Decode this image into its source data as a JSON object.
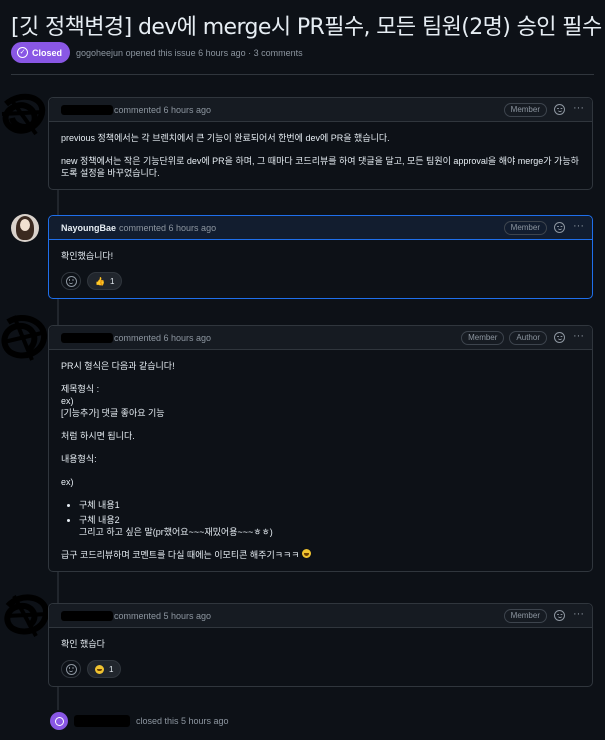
{
  "issue": {
    "title": "[깃 정책변경] dev에 merge시 PR필수, 모든 팀원(2명) 승인 필수",
    "state": "Closed",
    "meta": "gogoheejun opened this issue 6 hours ago · 3 comments"
  },
  "colors": {
    "background": "#0d1117",
    "closed_purple": "#8957e5",
    "highlight_blue": "#1f6feb",
    "border": "#30363d"
  },
  "comments": [
    {
      "author": "",
      "when": "commented 6 hours ago",
      "roles": [
        "Member"
      ],
      "body": [
        "previous 정책에서는 각 브렌치에서 큰 기능이 완료되어서 한번에 dev에 PR을 했습니다.",
        "new 정책에서는 작은 기능단위로 dev에 PR을 하며, 그 때마다 코드리뷰를 하여 댓글을 달고, 모든 팀원이 approval을 해야 merge가 가능하도록 설정을 바꾸었습니다."
      ]
    },
    {
      "author": "NayoungBae",
      "when": "commented 6 hours ago",
      "roles": [
        "Member"
      ],
      "body": [
        "확인했습니다!"
      ],
      "reaction": {
        "emoji": "thumbs-up",
        "glyph": "👍",
        "count": "1"
      }
    },
    {
      "author": "",
      "when": "commented 6 hours ago",
      "roles": [
        "Member",
        "Author"
      ],
      "body": [
        "PR시 형식은 다음과 같습니다!",
        "제목형식 :",
        "ex)",
        "[기능추가] 댓글 좋아요 기능",
        "처럼 하시면 됩니다.",
        "내용형식:",
        "ex)"
      ],
      "list": [
        "구체 내용1",
        "구체 내용2",
        "그리고 하고 싶은 말(pr했어요~~~재밌어용~~~ㅎㅎ)"
      ],
      "footer": "급구 코드리뷰하며 코멘트를 다실 때에는 이모티콘 해주기ㅋㅋㅋ"
    },
    {
      "author": "",
      "when": "commented 5 hours ago",
      "roles": [
        "Member"
      ],
      "body": [
        "확인 했습다"
      ],
      "reaction": {
        "emoji": "smile",
        "count": "1"
      }
    }
  ],
  "closed_event": {
    "actor": "",
    "text": "closed this 5 hours ago"
  }
}
